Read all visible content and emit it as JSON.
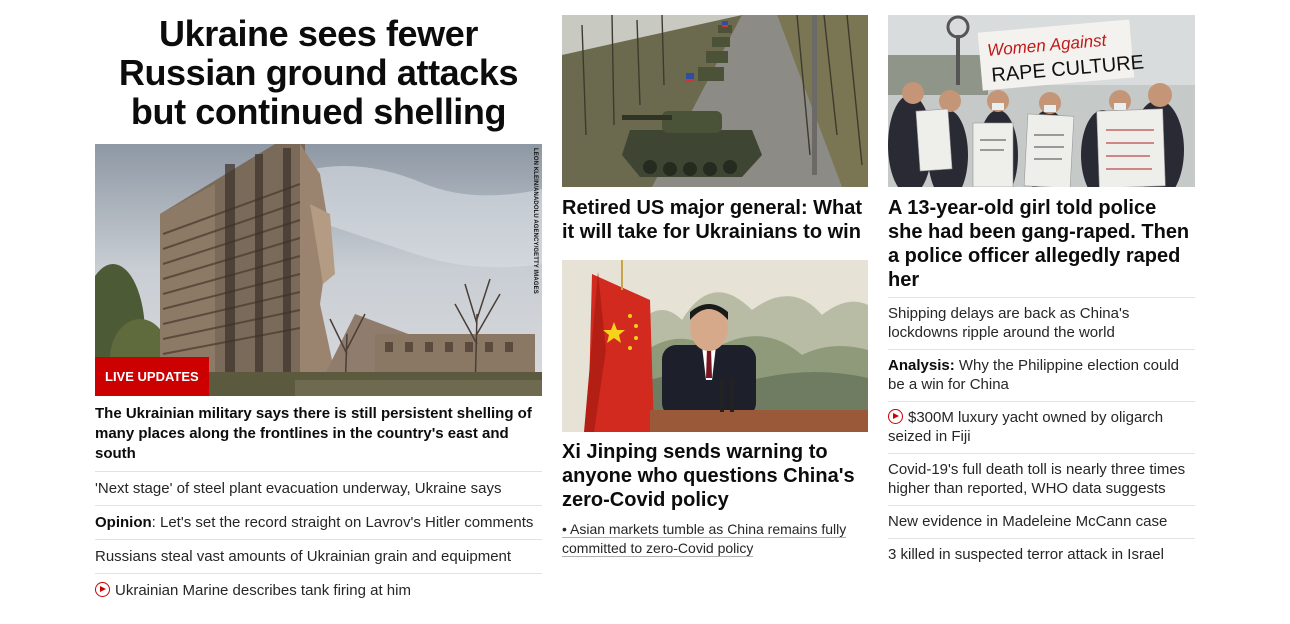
{
  "lead": {
    "title": "Ukraine sees fewer Russian ground attacks but continued shelling",
    "photo_credit": "LEON KLEIN/ANADOLU AGENCY/GETTY IMAGES",
    "badge": "LIVE UPDATES",
    "subhead": "The Ukrainian military says there is still persistent shelling of many places along the frontlines in the country's east and south",
    "links": [
      {
        "prefix": "",
        "text": "'Next stage' of steel plant evacuation underway, Ukraine says",
        "video": false
      },
      {
        "prefix": "Opinion",
        "text": ": Let's set the record straight on Lavrov's Hitler comments",
        "video": false
      },
      {
        "prefix": "",
        "text": "Russians steal vast amounts of Ukrainian grain and equipment",
        "video": false
      },
      {
        "prefix": "",
        "text": "Ukrainian Marine describes tank firing at him",
        "video": true
      }
    ]
  },
  "middle": {
    "story1": {
      "title": "Retired US major general: What it will take for Ukrainians to win"
    },
    "story2": {
      "title": "Xi Jinping sends warning to anyone who questions China's zero-Covid policy",
      "bullet": "• Asian markets tumble as China remains fully committed to zero-Covid policy"
    }
  },
  "right": {
    "story": {
      "title": "A 13-year-old girl told police she had been gang-raped. Then a police officer allegedly raped her"
    },
    "sign_text": {
      "line1": "Women Against",
      "line2": "RAPE CULTURE"
    },
    "links": [
      {
        "prefix": "",
        "text": "Shipping delays are back as China's lockdowns ripple around the world",
        "video": false
      },
      {
        "prefix": "Analysis:",
        "text": " Why the Philippine election could be a win for China",
        "video": false
      },
      {
        "prefix": "",
        "text": "$300M luxury yacht owned by oligarch seized in Fiji",
        "video": true
      },
      {
        "prefix": "",
        "text": "Covid-19's full death toll is nearly three times higher than reported, WHO data suggests",
        "video": false
      },
      {
        "prefix": "",
        "text": "New evidence in Madeleine McCann case",
        "video": false
      },
      {
        "prefix": "",
        "text": "3 killed in suspected terror attack in Israel",
        "video": false
      }
    ]
  },
  "colors": {
    "live_red": "#cc0000",
    "text": "#0c0c0c",
    "divider": "#e2e2e2"
  }
}
